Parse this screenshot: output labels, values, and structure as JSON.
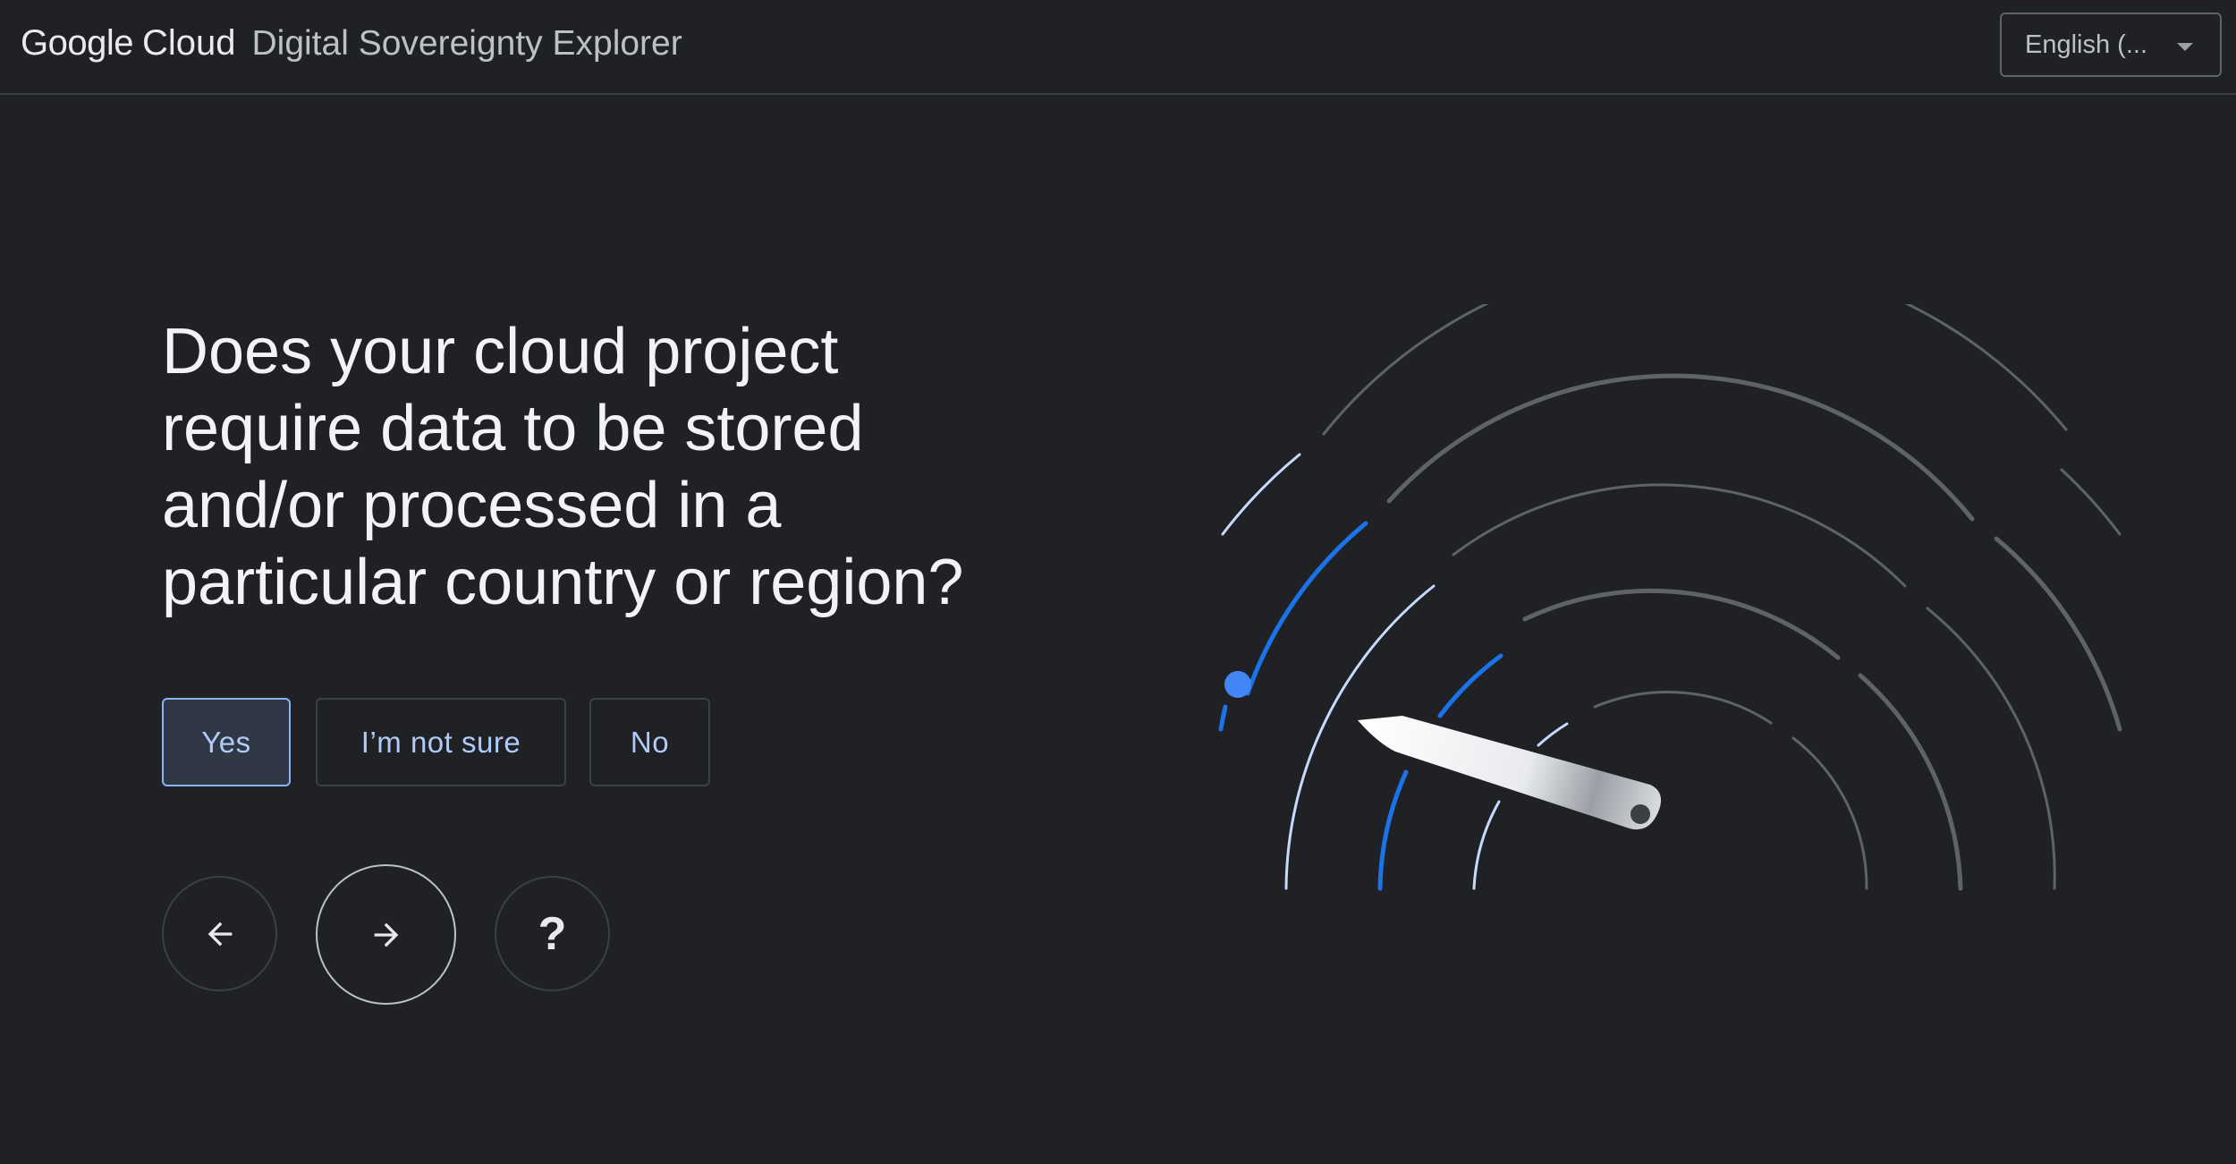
{
  "header": {
    "brand_google": "Google",
    "brand_cloud": "Cloud",
    "product_name": "Digital Sovereignty Explorer",
    "language_select": {
      "selected": "English (...",
      "icon": "dropdown-caret"
    }
  },
  "main": {
    "question": "Does your cloud project require data to be stored and/or processed in a particular country or region?",
    "answers": [
      {
        "label": "Yes",
        "selected": true
      },
      {
        "label": "I’m not sure",
        "selected": false
      },
      {
        "label": "No",
        "selected": false
      }
    ],
    "navigation": {
      "back_icon": "arrow-left-icon",
      "next_icon": "arrow-right-icon",
      "help_label": "?"
    }
  },
  "illustration": {
    "type": "radar-gauge",
    "accent_color": "#1a73e8",
    "dot_color": "#4285f4",
    "arc_color": "#5f6368",
    "light_arc_color": "#c6dafc"
  }
}
